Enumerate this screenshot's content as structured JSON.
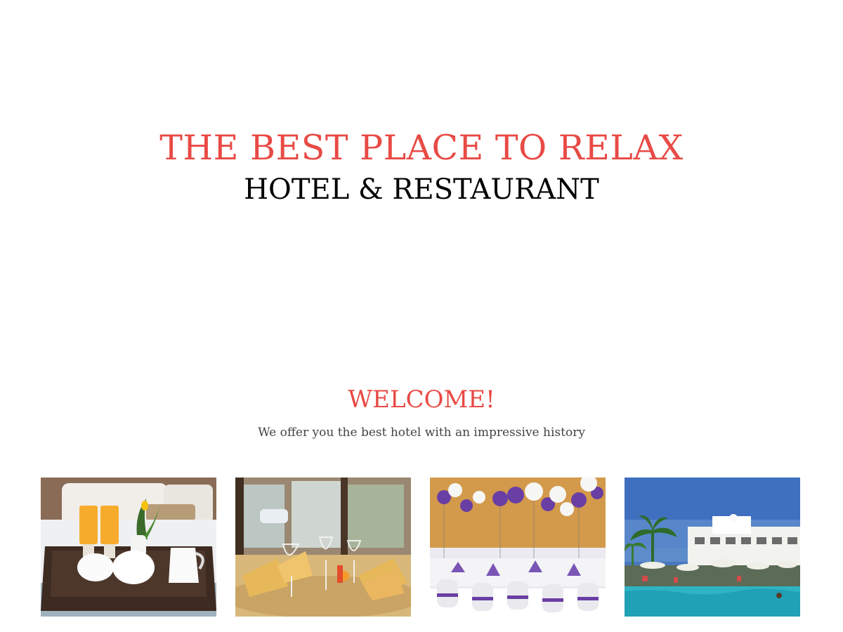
{
  "hero": {
    "title": "THE BEST PLACE TO RELAX",
    "subtitle": "HOTEL & RESTAURANT"
  },
  "welcome": {
    "title": "WELCOME!",
    "text": "We offer you the best hotel with an impressive history"
  },
  "colors": {
    "accent": "#e84a45",
    "heading": "#000000",
    "body_text": "#444444",
    "background": "#ffffff"
  },
  "gallery": [
    {
      "icon": "breakfast-tray-photo"
    },
    {
      "icon": "restaurant-table-photo"
    },
    {
      "icon": "banquet-hall-photo"
    },
    {
      "icon": "resort-pool-photo"
    }
  ]
}
